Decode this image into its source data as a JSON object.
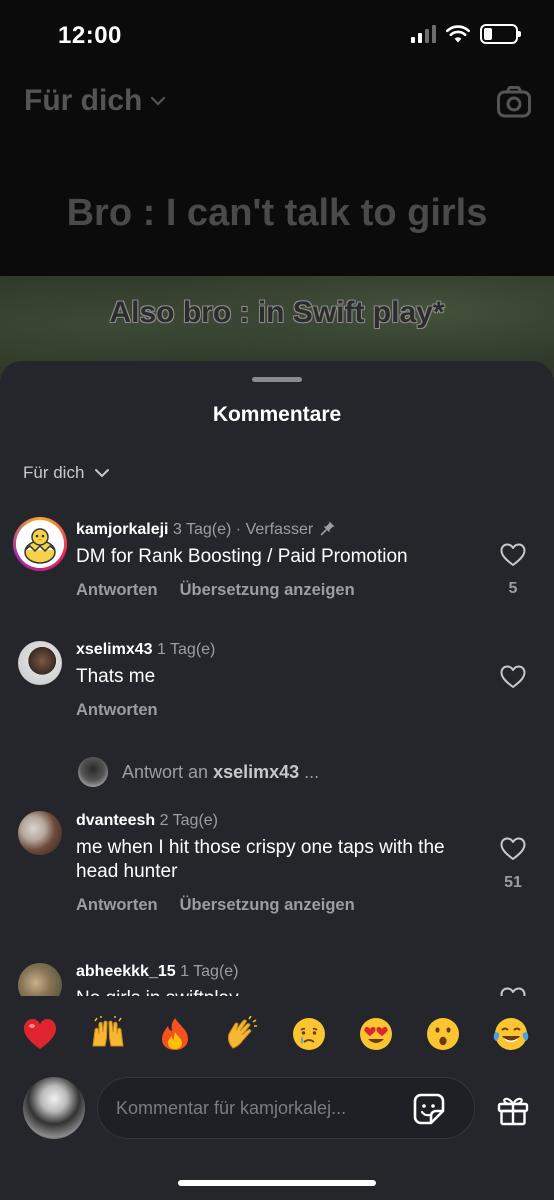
{
  "status_bar": {
    "time": "12:00"
  },
  "background": {
    "feed_title": "Für dich",
    "reel_line1": "Bro : I can't talk to girls",
    "reel_line2": "Also bro : in Swift play*"
  },
  "sheet": {
    "title": "Kommentare",
    "sort_label": "Für dich"
  },
  "comments": [
    {
      "username": "kamjorkaleji",
      "meta": "3 Tag(e) · Verfasser",
      "pinned": true,
      "text": "DM for Rank Boosting / Paid Promotion",
      "reply_label": "Antworten",
      "translate_label": "Übersetzung anzeigen",
      "likes": "5"
    },
    {
      "username": "xselimx43",
      "meta": "1 Tag(e)",
      "text": "Thats me",
      "reply_label": "Antworten"
    },
    {
      "username": "dvanteesh",
      "meta": "2 Tag(e)",
      "text": "me when I hit those crispy one taps with the head hunter",
      "reply_label": "Antworten",
      "translate_label": "Übersetzung anzeigen",
      "likes": "51"
    },
    {
      "username": "abheekkk_15",
      "meta": "1 Tag(e)",
      "text": "No girls in swiftplay"
    }
  ],
  "reply_thread": {
    "prefix": "Antwort an",
    "username": "xselimx43",
    "suffix": "..."
  },
  "quick_emojis": [
    "red-heart",
    "raising-hands",
    "fire",
    "clapping-hands",
    "crying-face",
    "heart-eyes",
    "astonished-face",
    "tears-of-joy"
  ],
  "composer": {
    "placeholder": "Kommentar für kamjorkalej..."
  },
  "colors": {
    "sheet_bg": "#25262b",
    "secondary_text": "#9c9da2",
    "background": "#000000"
  }
}
